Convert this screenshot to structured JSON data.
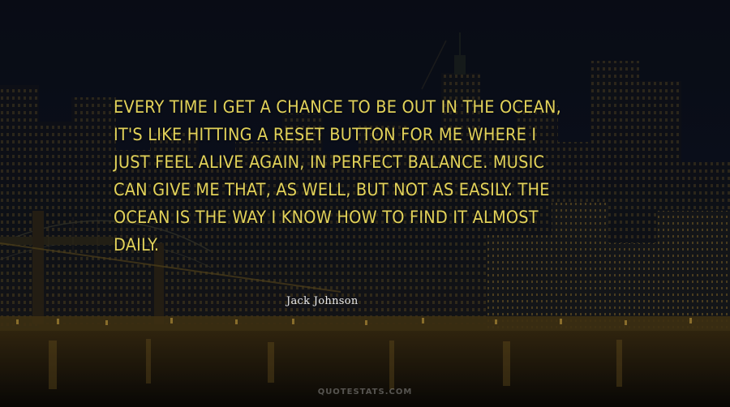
{
  "quote": {
    "lines": [
      "EVERY TIME I GET A CHANCE TO BE OUT IN THE OCEAN,",
      "IT'S LIKE HITTING A RESET BUTTON FOR ME WHERE I",
      "JUST FEEL ALIVE AGAIN, IN PERFECT BALANCE. MUSIC",
      "CAN GIVE ME THAT, AS WELL, BUT NOT AS EASILY. THE",
      "OCEAN IS THE WAY I KNOW HOW TO FIND IT ALMOST",
      "DAILY."
    ],
    "color": "#e2d25a"
  },
  "author": "Jack Johnson",
  "watermark": "QUOTESTATS.COM"
}
